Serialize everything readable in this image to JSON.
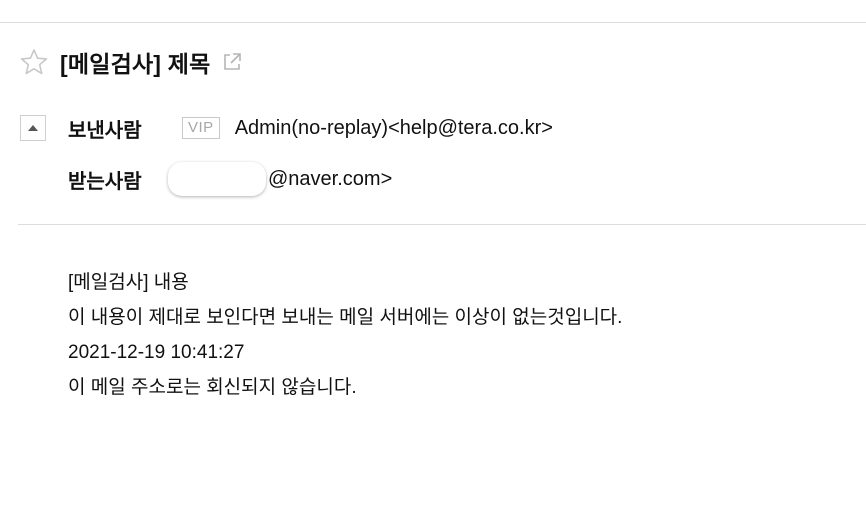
{
  "mail": {
    "subject": "[메일검사] 제목",
    "sender": {
      "label": "보낸사람",
      "badge": "VIP",
      "value": "Admin(no-replay)<help@tera.co.kr>"
    },
    "recipient": {
      "label": "받는사람",
      "domain": "@naver.com>"
    },
    "body": {
      "lines": [
        "[메일검사] 내용",
        "이 내용이 제대로 보인다면 보내는 메일 서버에는 이상이 없는것입니다.",
        "2021-12-19 10:41:27",
        "이 메일 주소로는 회신되지 않습니다."
      ]
    }
  },
  "icons": {
    "star": "star-outline-icon",
    "popout": "external-link-icon",
    "toggle": "caret-up-icon"
  },
  "colors": {
    "divider": "#dcdcdc",
    "text": "#111111",
    "icon_gray": "#c8c8c8"
  }
}
